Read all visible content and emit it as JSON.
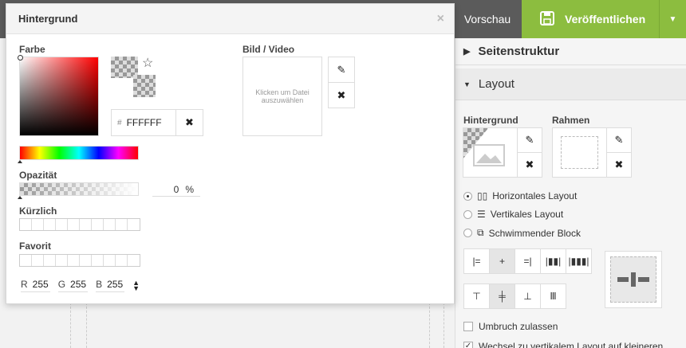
{
  "topbar": {
    "preview_label": "Vorschau",
    "publish_label": "Veröffentlichen",
    "publish_caret": "▼"
  },
  "dialog": {
    "title": "Hintergrund",
    "close": "×",
    "color_label": "Farbe",
    "hex_prefix": "#",
    "hex_value": "FFFFFF",
    "clear_symbol": "✖",
    "opacity_label": "Opazität",
    "opacity_value": "0",
    "opacity_unit": "%",
    "recent_label": "Kürzlich",
    "favorite_label": "Favorit",
    "rgb": {
      "r_label": "R",
      "r_value": "255",
      "g_label": "G",
      "g_value": "255",
      "b_label": "B",
      "b_value": "255"
    },
    "media_label": "Bild / Video",
    "media_placeholder": "Klicken um Datei auszuwählen",
    "edit_symbol": "✎"
  },
  "panel": {
    "section_structure": "Seitenstruktur",
    "section_layout": "Layout",
    "background_label": "Hintergrund",
    "border_label": "Rahmen",
    "layout_options": [
      {
        "label": "Horizontales Layout",
        "selected": true
      },
      {
        "label": "Vertikales Layout",
        "selected": false
      },
      {
        "label": "Schwimmender Block",
        "selected": false
      }
    ],
    "wrap_label": "Umbruch zulassen",
    "wrap_checked": false,
    "switch_label": "Wechsel zu vertikalem Layout auf kleineren",
    "switch_checked": true
  },
  "colors": {
    "accent_green": "#8cbd3f",
    "topbar": "#5b5b5b"
  }
}
